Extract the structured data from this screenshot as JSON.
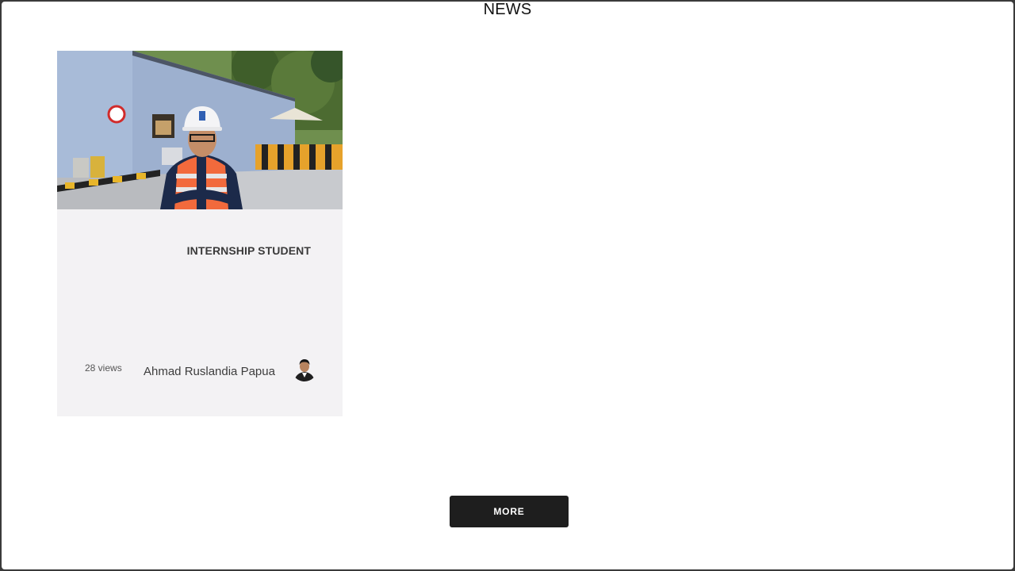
{
  "section": {
    "title": "NEWS"
  },
  "card": {
    "title": "INTERNSHIP STUDENT",
    "views": "28 views",
    "author": "Ahmad Ruslandia Papua",
    "image_icon": "worker-photo",
    "avatar_icon": "author-avatar"
  },
  "more_button": {
    "label": "MORE"
  },
  "colors": {
    "page_background": "#ffffff",
    "card_background": "#f3f2f4",
    "button_background": "#1e1e1e",
    "button_text": "#ffffff",
    "text_dark": "#3b3b3b"
  }
}
